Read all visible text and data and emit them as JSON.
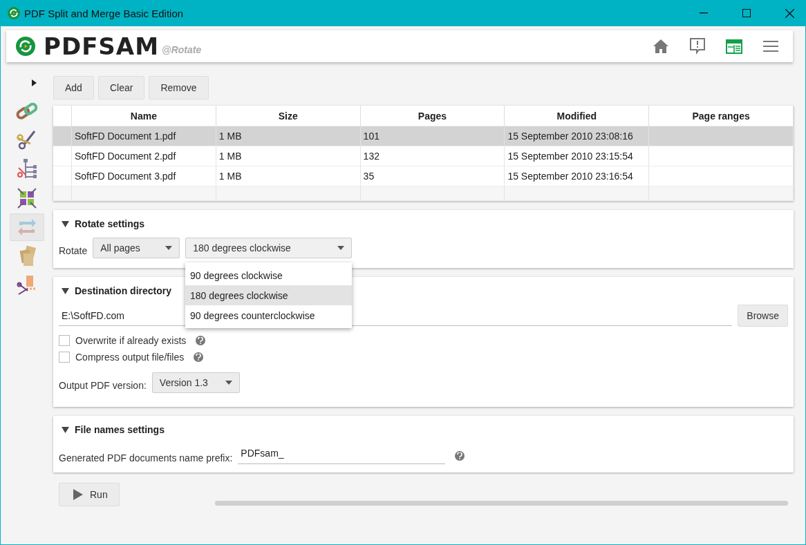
{
  "window": {
    "title": "PDF Split and Merge Basic Edition"
  },
  "header": {
    "logo": "PDFSAM",
    "module": "@Rotate",
    "nav": [
      {
        "kind": "home",
        "selected": false
      },
      {
        "kind": "news",
        "selected": false
      },
      {
        "kind": "dashboard",
        "selected": true
      },
      {
        "kind": "menu",
        "selected": false
      }
    ]
  },
  "sidebar": {
    "expanded": false,
    "tools": [
      {
        "kind": "merge",
        "selected": false
      },
      {
        "kind": "split",
        "selected": false
      },
      {
        "kind": "splitbookmarks",
        "selected": false
      },
      {
        "kind": "alternate",
        "selected": false
      },
      {
        "kind": "rotate",
        "selected": true
      },
      {
        "kind": "extract",
        "selected": false
      },
      {
        "kind": "splitsize",
        "selected": false
      }
    ]
  },
  "toolbar": [
    "Add",
    "Clear",
    "Remove"
  ],
  "table": {
    "columns": [
      "Name",
      "Size",
      "Pages",
      "Modified",
      "Page ranges"
    ],
    "rows": [
      {
        "selected": true,
        "cells": [
          "SoftFD Document 1.pdf",
          "1 MB",
          "101",
          "15 September 2010 23:08:16",
          null
        ]
      },
      {
        "selected": false,
        "cells": [
          "SoftFD Document 2.pdf",
          "1 MB",
          "132",
          "15 September 2010 23:15:54",
          null
        ]
      },
      {
        "selected": false,
        "cells": [
          "SoftFD Document 3.pdf",
          "1 MB",
          "35",
          "15 September 2010 23:16:54",
          null
        ]
      }
    ]
  },
  "rotate_settings": {
    "title": "Rotate settings",
    "expanded": true,
    "label": "Rotate",
    "pages_select": "All pages",
    "rotation_select": "180 degrees clockwise",
    "rotation_options": [
      {
        "label": "90 degrees clockwise",
        "selected": false
      },
      {
        "label": "180 degrees clockwise",
        "selected": true
      },
      {
        "label": "90 degrees counterclockwise",
        "selected": false
      }
    ]
  },
  "destination": {
    "title": "Destination directory",
    "expanded": true,
    "path": "E:\\SoftFD.com",
    "browse": "Browse",
    "options": [
      {
        "label": "Overwrite if already exists",
        "checked": false
      },
      {
        "label": "Compress output file/files",
        "checked": false
      }
    ],
    "version_label": "Output PDF version:",
    "version": "Version 1.3"
  },
  "file_names": {
    "title": "File names settings",
    "expanded": true,
    "label": "Generated PDF documents name prefix:",
    "prefix": "PDFsam_"
  },
  "run": "Run",
  "progress": {
    "level": 0
  }
}
